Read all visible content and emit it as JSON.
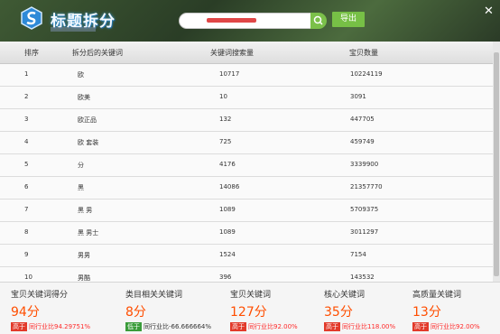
{
  "header": {
    "logo_text": "标题拆分",
    "export_label": "导出",
    "close_glyph": "✕",
    "search_value": ""
  },
  "table": {
    "columns": [
      "排序",
      "拆分后的关键词",
      "关键词搜索量",
      "宝贝数量"
    ],
    "rows": [
      [
        "1",
        "欧",
        "10717",
        "10224119"
      ],
      [
        "2",
        "欧美",
        "10",
        "3091"
      ],
      [
        "3",
        "欧正品",
        "132",
        "447705"
      ],
      [
        "4",
        "欧 套装",
        "725",
        "459749"
      ],
      [
        "5",
        "分",
        "4176",
        "3339900"
      ],
      [
        "6",
        "黑",
        "14086",
        "21357770"
      ],
      [
        "7",
        "黑 男",
        "1089",
        "5709375"
      ],
      [
        "8",
        "黑 男士",
        "1089",
        "3011297"
      ],
      [
        "9",
        "男男",
        "1524",
        "7154"
      ],
      [
        "10",
        "男酷",
        "396",
        "143532"
      ]
    ]
  },
  "footer": {
    "stats": [
      {
        "title": "宝贝关键词得分",
        "value": "94分",
        "badge": "高于",
        "badge_type": "up",
        "compare": "同行业比94.29751%"
      },
      {
        "title": "类目相关关键词",
        "value": "8分",
        "badge": "低于",
        "badge_type": "down",
        "compare": "同行业比-66.666664%"
      },
      {
        "title": "宝贝关键词",
        "value": "127分",
        "badge": "高于",
        "badge_type": "up",
        "compare": "同行业比92.00%"
      },
      {
        "title": "核心关键词",
        "value": "35分",
        "badge": "高于",
        "badge_type": "up",
        "compare": "同行业比118.00%"
      },
      {
        "title": "高质量关键词",
        "value": "13分",
        "badge": "高于",
        "badge_type": "up",
        "compare": "同行业比92.00%"
      }
    ]
  },
  "icons": [
    "app-logo-icon",
    "search-icon",
    "close-icon"
  ],
  "colors": {
    "accent_green": "#77c046",
    "score_orange": "#ff4e00",
    "badge_red": "#e23a2a",
    "badge_green": "#3a9c3a"
  }
}
